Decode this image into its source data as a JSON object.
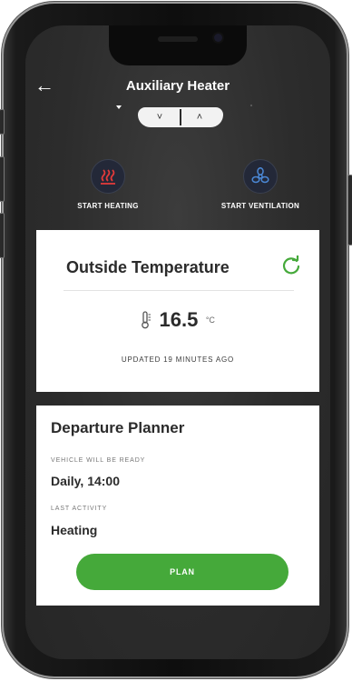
{
  "header": {
    "back_icon": "arrow-left-icon",
    "title": "Auxiliary Heater"
  },
  "actions": [
    {
      "label": "START HEATING",
      "icon": "heating-icon",
      "icon_color": "#e23a3a"
    },
    {
      "label": "START VENTILATION",
      "icon": "ventilation-fan-icon",
      "icon_color": "#4b88d6"
    }
  ],
  "outside_temperature": {
    "title": "Outside Temperature",
    "refresh_icon": "refresh-icon",
    "value": "16.5",
    "unit": "°C",
    "updated": "UPDATED 19 MINUTES AGO"
  },
  "departure_planner": {
    "title": "Departure Planner",
    "ready_label": "VEHICLE WILL BE READY",
    "ready_value": "Daily, 14:00",
    "activity_label": "LAST ACTIVITY",
    "activity_value": "Heating",
    "plan_button": "PLAN"
  },
  "colors": {
    "accent_green": "#45a93a",
    "background_dark": "#2c2c2c"
  }
}
